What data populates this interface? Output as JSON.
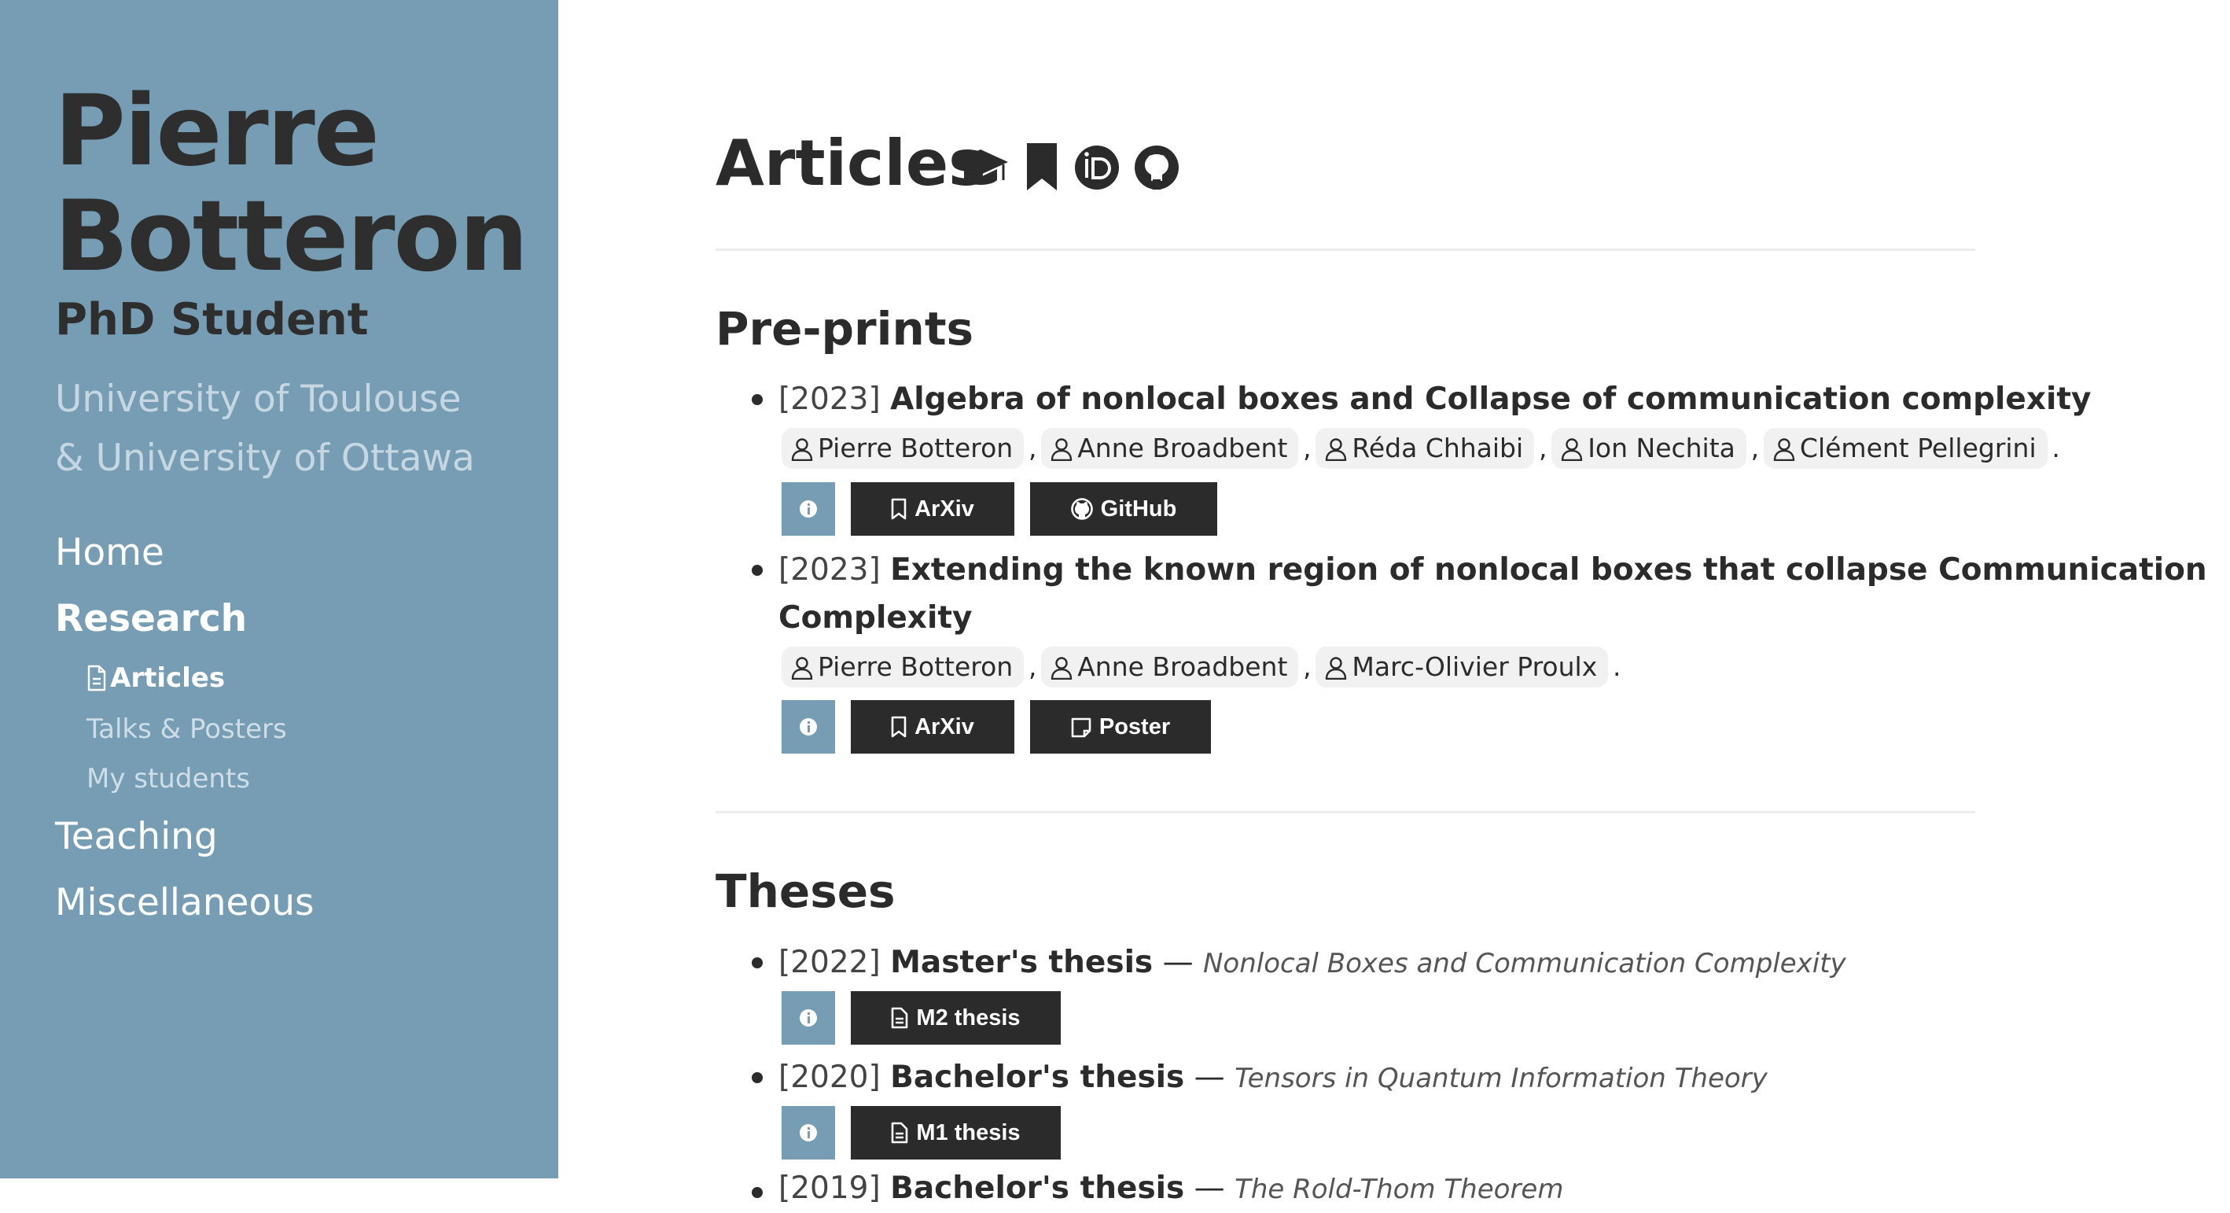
{
  "sidebar": {
    "name_first": "Pierre",
    "name_last": "Botteron",
    "role": "PhD Student",
    "affiliation_1": "University of Toulouse",
    "affiliation_2": "& University of Ottawa",
    "nav": {
      "home": "Home",
      "research": "Research",
      "articles": "Articles",
      "talks": "Talks & Posters",
      "students": "My students",
      "teaching": "Teaching",
      "misc": "Miscellaneous"
    }
  },
  "header": {
    "title": "Articles",
    "icons": [
      "graduation-cap-icon",
      "bookmark-icon",
      "orcid-icon",
      "github-icon"
    ]
  },
  "preprints": {
    "title": "Pre-prints",
    "items": [
      {
        "year": "[2023]",
        "title": "Algebra of nonlocal boxes and Collapse of communication complexity",
        "authors": [
          "Pierre Botteron",
          "Anne Broadbent",
          "Réda Chhaibi",
          "Ion Nechita",
          "Clément Pellegrini"
        ],
        "buttons": [
          "ArXiv",
          "GitHub"
        ]
      },
      {
        "year": "[2023]",
        "title_line1": "Extending the known region of nonlocal boxes that collapse Communication",
        "title_line2": "Complexity",
        "authors": [
          "Pierre Botteron",
          "Anne Broadbent",
          "Marc-Olivier Proulx"
        ],
        "buttons": [
          "ArXiv",
          "Poster"
        ]
      }
    ]
  },
  "theses": {
    "title": "Theses",
    "items": [
      {
        "year": "[2022]",
        "title": "Master's thesis",
        "dash": "—",
        "subtitle": "Nonlocal Boxes and Communication Complexity",
        "button": "M2 thesis"
      },
      {
        "year": "[2020]",
        "title": "Bachelor's thesis",
        "dash": "—",
        "subtitle": "Tensors in Quantum Information Theory",
        "button": "M1 thesis"
      },
      {
        "year": "[2019]",
        "title": "Bachelor's thesis",
        "dash": "—",
        "subtitle": "The Rold-Thom Theorem"
      }
    ]
  },
  "colors": {
    "sidebar": "#769db4",
    "button_dark": "#2b2b2b",
    "chip": "#f1f1f1"
  },
  "punct": {
    "comma": ",",
    "period": "."
  }
}
